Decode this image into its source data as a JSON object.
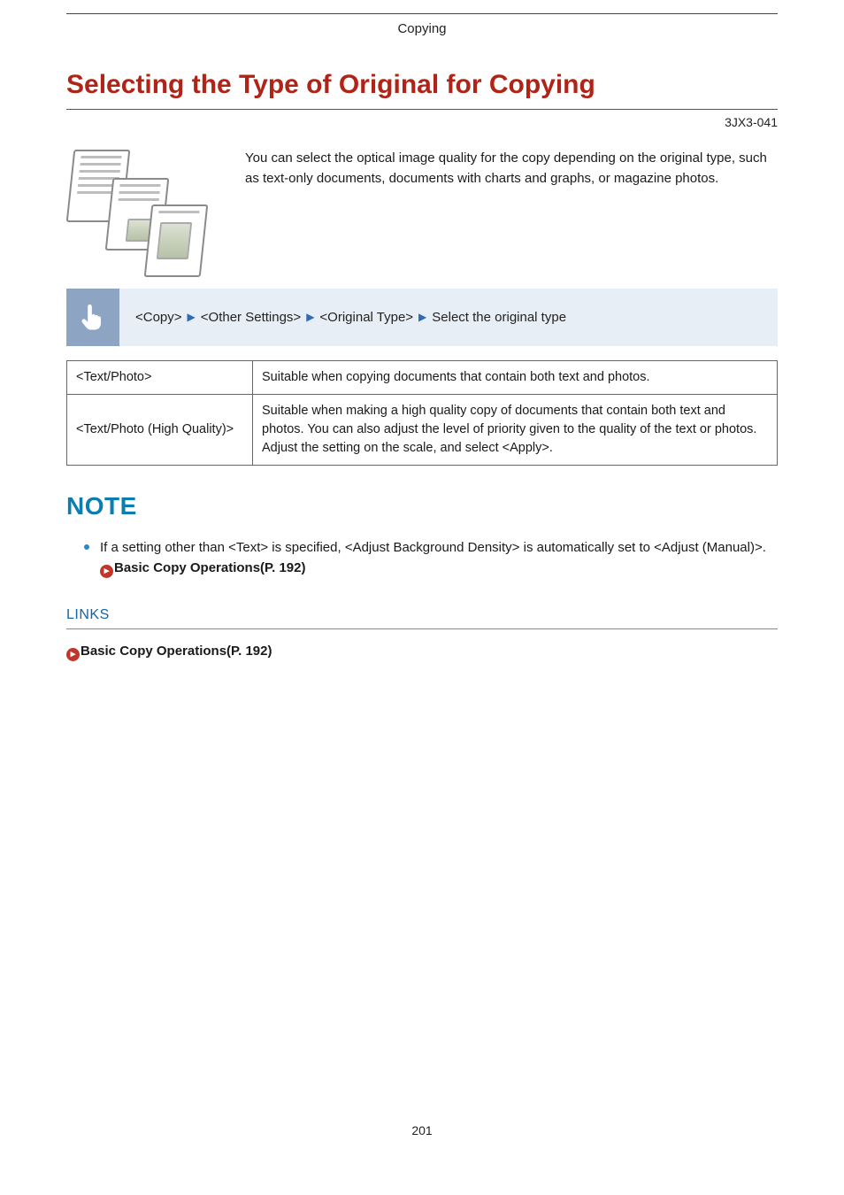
{
  "header": {
    "section": "Copying"
  },
  "title": "Selecting the Type of Original for Copying",
  "doc_code": "3JX3-041",
  "intro": "You can select the optical image quality for the copy depending on the original type, such as text-only documents, documents with charts and graphs, or magazine photos.",
  "steps": {
    "s1": "<Copy>",
    "s2": "<Other Settings>",
    "s3": "<Original Type>",
    "s4": "Select the original type"
  },
  "table": {
    "rows": [
      {
        "label": "<Text/Photo>",
        "desc": "Suitable when copying documents that contain both text and photos."
      },
      {
        "label": "<Text/Photo (High Quality)>",
        "desc": "Suitable when making a high quality copy of documents that contain both text and photos. You can also adjust the level of priority given to the quality of the text or photos. Adjust the setting on the scale, and select <Apply>."
      }
    ]
  },
  "note": {
    "heading": "NOTE",
    "item_prefix": "If a setting other than <Text> is specified, <Adjust Background Density> is automatically set to <Adjust (Manual)>. ",
    "item_link": "Basic Copy Operations(P. 192)"
  },
  "links": {
    "heading": "LINKS",
    "item": "Basic Copy Operations(P. 192)"
  },
  "page_number": "201"
}
